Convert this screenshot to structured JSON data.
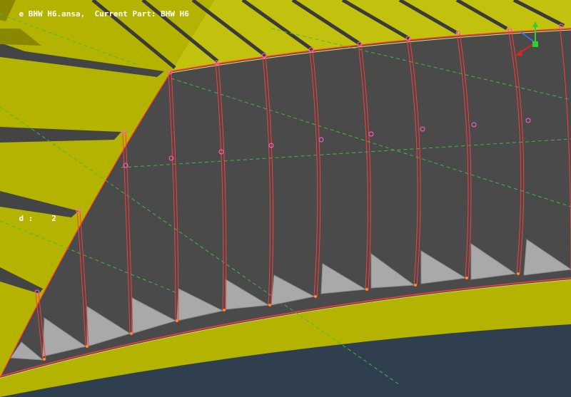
{
  "viewport": {
    "title_prefix": "e BHW H6.ansa,  Current Part: BHW H6",
    "side_label": "d :",
    "side_value": "2"
  },
  "axis_triad": {
    "x_label": "",
    "y_label": "",
    "z_label": ""
  },
  "colors": {
    "background": "#2f3f4f",
    "yellow_face": "#b4b400",
    "yellow_face_light": "#c7c61a",
    "yellow_face_dark": "#8a8700",
    "shell_gray": "#4a4a4a",
    "gusset_gray": "#a9a9a9",
    "red_edge": "#ff3b3b",
    "pink_node": "#ff66cc",
    "green_dashed": "#3dbb3d",
    "orange_node": "#ff8a2a"
  }
}
